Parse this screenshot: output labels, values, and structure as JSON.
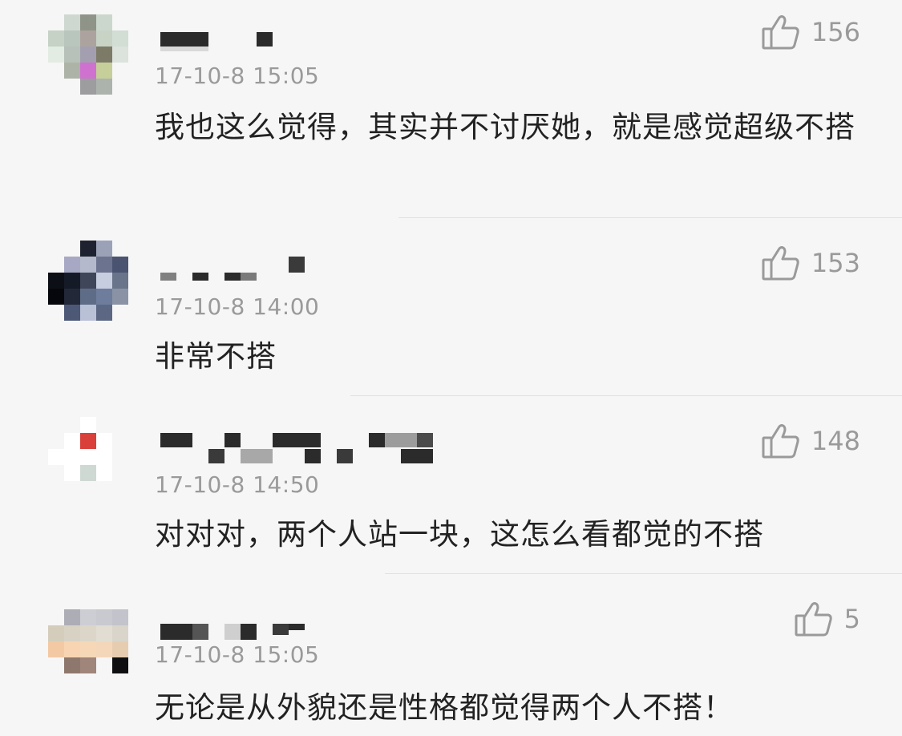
{
  "comments": [
    {
      "time": "17-10-8 15:05",
      "text": "我也这么觉得，其实并不讨厌她，就是感觉超级不搭",
      "likes": "156"
    },
    {
      "time": "17-10-8 14:00",
      "text": "非常不搭",
      "likes": "153"
    },
    {
      "time": "17-10-8 14:50",
      "text": "对对对，两个人站一块，这怎么看都觉的不搭",
      "likes": "148"
    },
    {
      "time": "17-10-8 15:05",
      "text": "无论是从外貌还是性格都觉得两个人不搭！",
      "likes": "5"
    }
  ],
  "colors": {
    "background": "#f6f6f6",
    "text": "#222222",
    "meta": "#9a9a9a",
    "divider": "#e2e2e2"
  },
  "icons": {
    "like": "thumbs-up-icon"
  }
}
